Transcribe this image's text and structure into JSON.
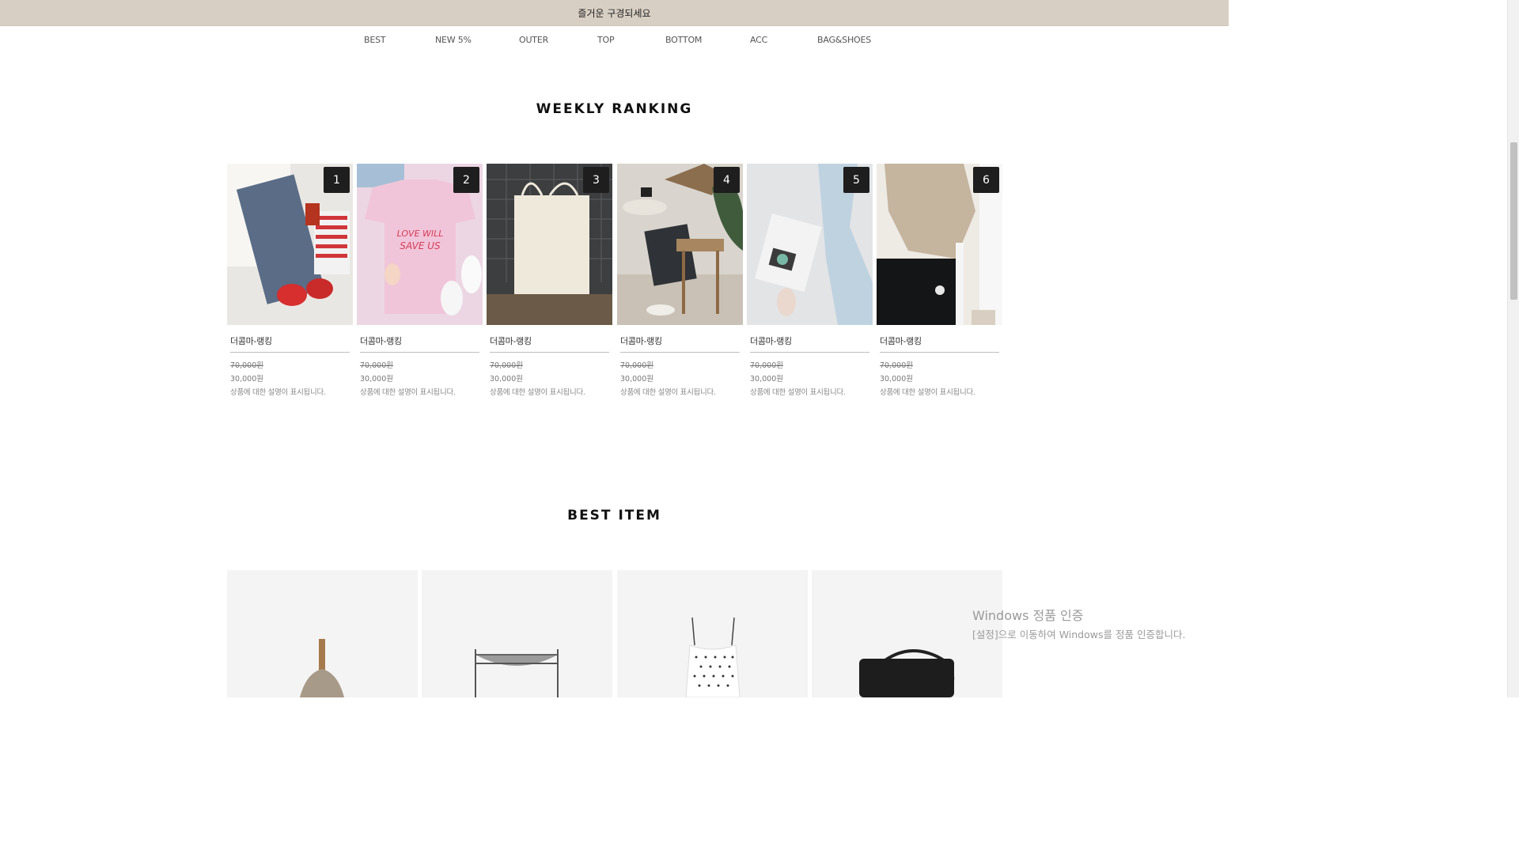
{
  "announcement": "즐거운 구경되세요",
  "nav": {
    "items": [
      "BEST",
      "NEW 5%",
      "OUTER",
      "TOP",
      "BOTTOM",
      "ACC",
      "BAG&SHOES"
    ]
  },
  "weekly_ranking": {
    "title": "WEEKLY RANKING",
    "items": [
      {
        "rank": "1",
        "name": "더콤마-랭킹",
        "old_price": "70,000원",
        "price": "30,000원",
        "desc": "상품에 대한 설명이 표시됩니다."
      },
      {
        "rank": "2",
        "name": "더콤마-랭킹",
        "old_price": "70,000원",
        "price": "30,000원",
        "desc": "상품에 대한 설명이 표시됩니다."
      },
      {
        "rank": "3",
        "name": "더콤마-랭킹",
        "old_price": "70,000원",
        "price": "30,000원",
        "desc": "상품에 대한 설명이 표시됩니다."
      },
      {
        "rank": "4",
        "name": "더콤마-랭킹",
        "old_price": "70,000원",
        "price": "30,000원",
        "desc": "상품에 대한 설명이 표시됩니다."
      },
      {
        "rank": "5",
        "name": "더콤마-랭킹",
        "old_price": "70,000원",
        "price": "30,000원",
        "desc": "상품에 대한 설명이 표시됩니다."
      },
      {
        "rank": "6",
        "name": "더콤마-랭킹",
        "old_price": "70,000원",
        "price": "30,000원",
        "desc": "상품에 대한 설명이 표시됩니다."
      }
    ]
  },
  "best_item": {
    "title": "BEST ITEM"
  },
  "watermark": {
    "line1": "Windows 정품 인증",
    "line2": "[설정]으로 이동하여 Windows를 정품 인증합니다."
  }
}
